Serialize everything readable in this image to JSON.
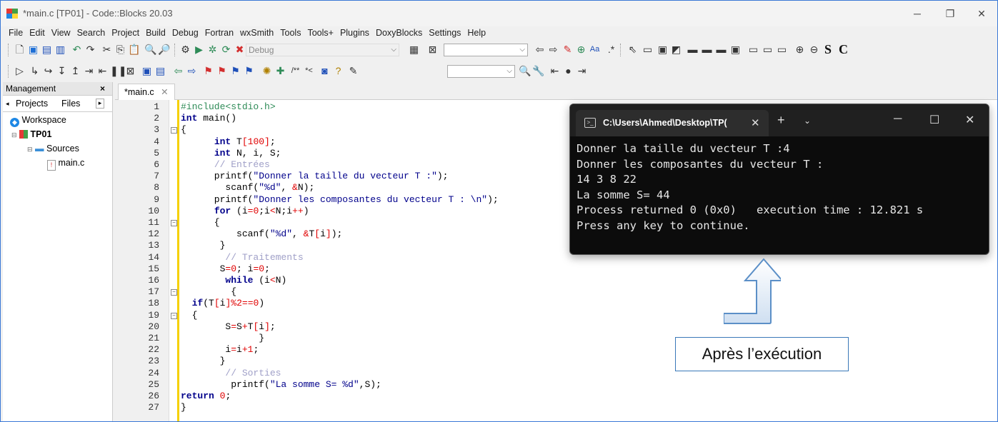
{
  "window": {
    "title": "*main.c [TP01] - Code::Blocks 20.03"
  },
  "menu": [
    "File",
    "Edit",
    "View",
    "Search",
    "Project",
    "Build",
    "Debug",
    "Fortran",
    "wxSmith",
    "Tools",
    "Tools+",
    "Plugins",
    "DoxyBlocks",
    "Settings",
    "Help"
  ],
  "toolbar": {
    "build_target": "Debug",
    "letters": [
      "S",
      "C"
    ]
  },
  "management": {
    "title": "Management",
    "tabs": [
      "Projects",
      "Files"
    ],
    "tree": {
      "workspace": "Workspace",
      "project": "TP01",
      "folder": "Sources",
      "file": "main.c"
    }
  },
  "editor": {
    "tab_label": "*main.c",
    "lines": [
      {
        "n": "1",
        "t": "#include<stdio.h>"
      },
      {
        "n": "2",
        "t": "int main()"
      },
      {
        "n": "3",
        "t": "{"
      },
      {
        "n": "4",
        "t": "      int T[100];"
      },
      {
        "n": "5",
        "t": "      int N, i, S;"
      },
      {
        "n": "6",
        "t": "      // Entrées"
      },
      {
        "n": "7",
        "t": "      printf(\"Donner la taille du vecteur T :\");"
      },
      {
        "n": "8",
        "t": "        scanf(\"%d\", &N);"
      },
      {
        "n": "9",
        "t": "      printf(\"Donner les composantes du vecteur T : \\n\");"
      },
      {
        "n": "10",
        "t": "      for (i=0;i<N;i++)"
      },
      {
        "n": "11",
        "t": "      {"
      },
      {
        "n": "12",
        "t": "          scanf(\"%d\", &T[i]);"
      },
      {
        "n": "13",
        "t": "       }"
      },
      {
        "n": "14",
        "t": "        // Traitements"
      },
      {
        "n": "15",
        "t": "       S=0; i=0;"
      },
      {
        "n": "16",
        "t": "        while (i<N)"
      },
      {
        "n": "17",
        "t": "         {"
      },
      {
        "n": "18",
        "t": "  if(T[i]%2==0)"
      },
      {
        "n": "19",
        "t": "  {"
      },
      {
        "n": "20",
        "t": "        S=S+T[i];"
      },
      {
        "n": "21",
        "t": "              }"
      },
      {
        "n": "22",
        "t": "        i=i+1;"
      },
      {
        "n": "23",
        "t": "       }"
      },
      {
        "n": "24",
        "t": "        // Sorties"
      },
      {
        "n": "25",
        "t": "         printf(\"La somme S= %d\",S);"
      },
      {
        "n": "26",
        "t": "return 0;"
      },
      {
        "n": "27",
        "t": "}"
      }
    ]
  },
  "console": {
    "title": "C:\\Users\\Ahmed\\Desktop\\TP(",
    "output": "Donner la taille du vecteur T :4\nDonner les composantes du vecteur T :\n14 3 8 22\nLa somme S= 44\nProcess returned 0 (0x0)   execution time : 12.821 s\nPress any key to continue."
  },
  "annotation": {
    "label": "Après l’exécution"
  },
  "colors": {
    "border": "#3a78d6",
    "highlight_bar": "#f6d000",
    "console_bg": "#0c0c0c"
  }
}
